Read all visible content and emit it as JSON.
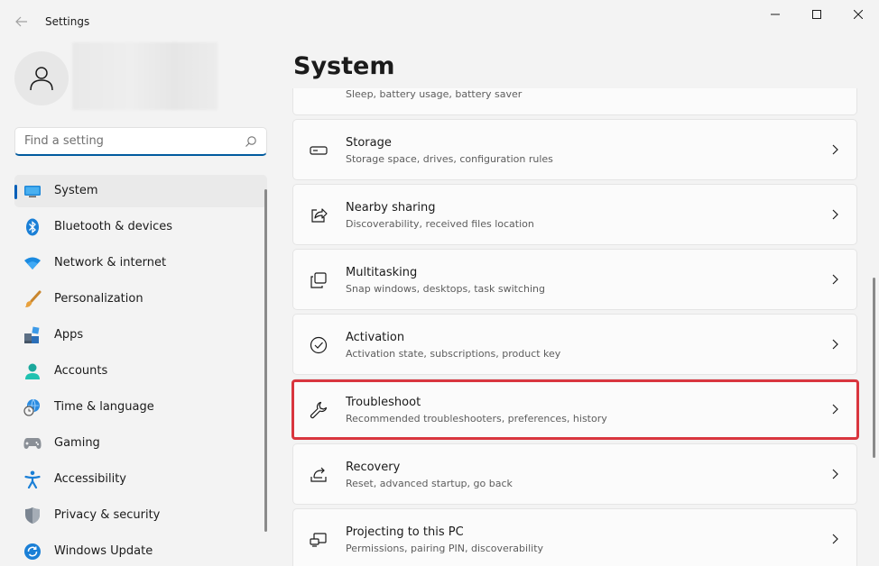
{
  "window": {
    "title": "Settings"
  },
  "search": {
    "placeholder": "Find a setting"
  },
  "nav": {
    "items": [
      {
        "label": "System",
        "icon": "monitor-icon",
        "active": true
      },
      {
        "label": "Bluetooth & devices",
        "icon": "bluetooth-icon"
      },
      {
        "label": "Network & internet",
        "icon": "wifi-icon"
      },
      {
        "label": "Personalization",
        "icon": "paintbrush-icon"
      },
      {
        "label": "Apps",
        "icon": "apps-icon"
      },
      {
        "label": "Accounts",
        "icon": "person-icon"
      },
      {
        "label": "Time & language",
        "icon": "globe-clock-icon"
      },
      {
        "label": "Gaming",
        "icon": "gamepad-icon"
      },
      {
        "label": "Accessibility",
        "icon": "accessibility-icon"
      },
      {
        "label": "Privacy & security",
        "icon": "shield-icon"
      },
      {
        "label": "Windows Update",
        "icon": "refresh-icon"
      }
    ]
  },
  "page": {
    "title": "System"
  },
  "cards": [
    {
      "title": "",
      "subtitle": "Sleep, battery usage, battery saver",
      "icon": "power-icon"
    },
    {
      "title": "Storage",
      "subtitle": "Storage space, drives, configuration rules",
      "icon": "storage-icon"
    },
    {
      "title": "Nearby sharing",
      "subtitle": "Discoverability, received files location",
      "icon": "share-icon"
    },
    {
      "title": "Multitasking",
      "subtitle": "Snap windows, desktops, task switching",
      "icon": "multitasking-icon"
    },
    {
      "title": "Activation",
      "subtitle": "Activation state, subscriptions, product key",
      "icon": "checkmark-circle-icon"
    },
    {
      "title": "Troubleshoot",
      "subtitle": "Recommended troubleshooters, preferences, history",
      "icon": "wrench-icon",
      "highlighted": true
    },
    {
      "title": "Recovery",
      "subtitle": "Reset, advanced startup, go back",
      "icon": "recovery-icon"
    },
    {
      "title": "Projecting to this PC",
      "subtitle": "Permissions, pairing PIN, discoverability",
      "icon": "projector-icon"
    }
  ],
  "colors": {
    "accent": "#005fb8",
    "highlight": "#d9363e",
    "background": "#f3f3f3",
    "card": "#fbfbfb"
  }
}
